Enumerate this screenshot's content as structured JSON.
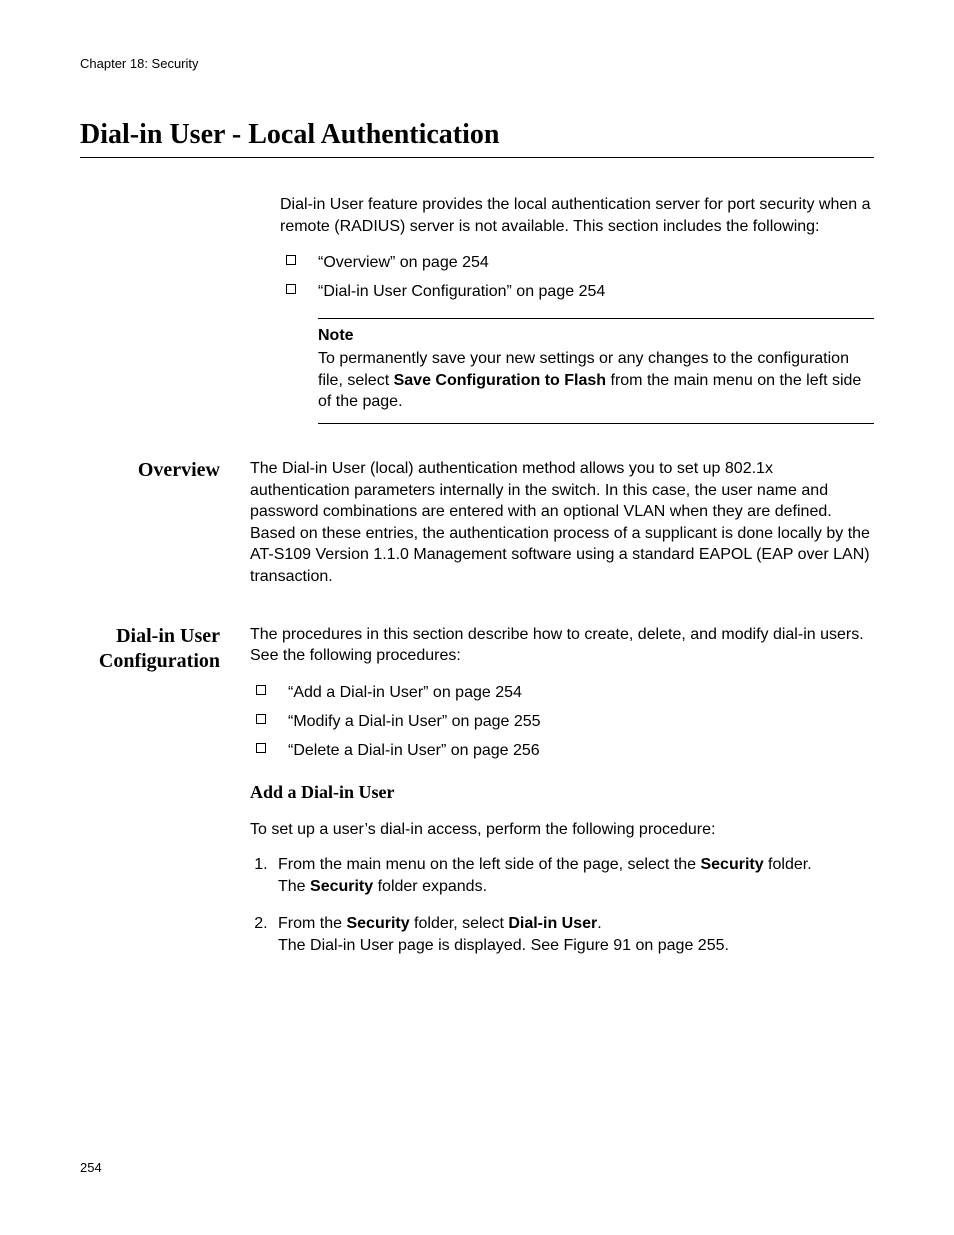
{
  "running_head": "Chapter 18: Security",
  "page_title": "Dial-in User - Local Authentication",
  "intro": "Dial-in User feature provides the local authentication server for port security when a remote (RADIUS) server is not available. This section includes the following:",
  "toc": [
    "“Overview” on page 254",
    "“Dial-in User Configuration” on page 254"
  ],
  "note": {
    "label": "Note",
    "before": "To permanently save your new settings or any changes to the configuration file, select ",
    "bold": "Save Configuration to Flash",
    "after": " from the main menu on the left side of the page."
  },
  "overview": {
    "label": "Overview",
    "text": "The Dial-in User (local) authentication method allows you to set up 802.1x authentication parameters internally in the switch. In this case, the user name and password combinations are entered with an optional VLAN when they are defined. Based on these entries, the authentication process of a supplicant is done locally by the AT-S109 Version 1.1.0  Management software using a standard EAPOL (EAP over LAN) transaction."
  },
  "config": {
    "label": "Dial-in User Configuration",
    "intro": "The procedures in this section describe how to create, delete, and modify dial-in users. See the following procedures:",
    "items": [
      "“Add a Dial-in User” on page 254",
      "“Modify a Dial-in User” on page 255",
      "“Delete a Dial-in User” on page 256"
    ]
  },
  "add": {
    "heading": "Add a Dial-in User",
    "lead": "To set up a user’s dial-in access, perform the following procedure:",
    "step1_a": "From the main menu on the left side of the page, select the ",
    "step1_b": "Security",
    "step1_c": " folder.",
    "step1_d_a": "The ",
    "step1_d_b": "Security",
    "step1_d_c": " folder expands.",
    "step2_a": "From the ",
    "step2_b": "Security",
    "step2_c": " folder, select ",
    "step2_d": "Dial-in User",
    "step2_e": ".",
    "step2_f": "The Dial-in User page is displayed. See Figure 91 on page 255."
  },
  "page_number": "254"
}
